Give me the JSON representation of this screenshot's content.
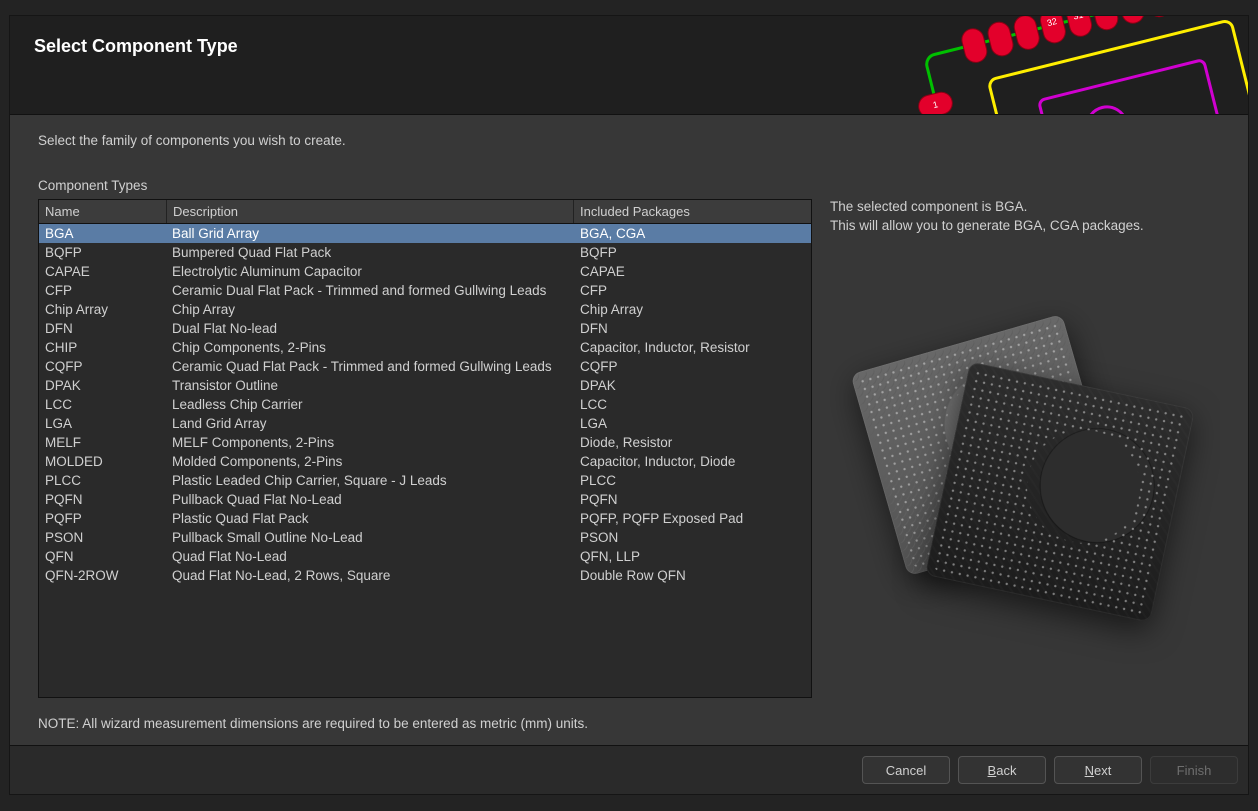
{
  "header": {
    "title": "Select Component Type"
  },
  "intro_text": "Select the family of components you wish to create.",
  "section_label": "Component Types",
  "table": {
    "headers": {
      "name": "Name",
      "description": "Description",
      "packages": "Included Packages"
    },
    "selected_index": 0,
    "rows": [
      {
        "name": "BGA",
        "desc": "Ball Grid Array",
        "pkg": "BGA, CGA"
      },
      {
        "name": "BQFP",
        "desc": "Bumpered Quad Flat Pack",
        "pkg": "BQFP"
      },
      {
        "name": "CAPAE",
        "desc": "Electrolytic Aluminum Capacitor",
        "pkg": "CAPAE"
      },
      {
        "name": "CFP",
        "desc": "Ceramic Dual Flat Pack - Trimmed and formed Gullwing Leads",
        "pkg": "CFP"
      },
      {
        "name": "Chip Array",
        "desc": "Chip Array",
        "pkg": "Chip Array"
      },
      {
        "name": "DFN",
        "desc": "Dual Flat No-lead",
        "pkg": "DFN"
      },
      {
        "name": "CHIP",
        "desc": "Chip Components, 2-Pins",
        "pkg": "Capacitor, Inductor, Resistor"
      },
      {
        "name": "CQFP",
        "desc": "Ceramic Quad Flat Pack - Trimmed and formed Gullwing Leads",
        "pkg": "CQFP"
      },
      {
        "name": "DPAK",
        "desc": "Transistor Outline",
        "pkg": "DPAK"
      },
      {
        "name": "LCC",
        "desc": "Leadless Chip Carrier",
        "pkg": "LCC"
      },
      {
        "name": "LGA",
        "desc": "Land Grid Array",
        "pkg": "LGA"
      },
      {
        "name": "MELF",
        "desc": "MELF Components, 2-Pins",
        "pkg": "Diode, Resistor"
      },
      {
        "name": "MOLDED",
        "desc": "Molded Components, 2-Pins",
        "pkg": "Capacitor, Inductor, Diode"
      },
      {
        "name": "PLCC",
        "desc": "Plastic Leaded Chip Carrier, Square - J Leads",
        "pkg": "PLCC"
      },
      {
        "name": "PQFN",
        "desc": "Pullback Quad Flat No-Lead",
        "pkg": "PQFN"
      },
      {
        "name": "PQFP",
        "desc": "Plastic Quad Flat Pack",
        "pkg": "PQFP, PQFP Exposed Pad"
      },
      {
        "name": "PSON",
        "desc": "Pullback Small Outline No-Lead",
        "pkg": "PSON"
      },
      {
        "name": "QFN",
        "desc": "Quad Flat No-Lead",
        "pkg": "QFN, LLP"
      },
      {
        "name": "QFN-2ROW",
        "desc": "Quad Flat No-Lead, 2 Rows, Square",
        "pkg": "Double Row QFN"
      }
    ]
  },
  "info": {
    "line1": "The selected component is BGA.",
    "line2": "This will allow you to generate BGA, CGA packages."
  },
  "note_text": "NOTE: All wizard measurement dimensions are required to be entered as metric (mm) units.",
  "footer": {
    "cancel": "Cancel",
    "back": "Back",
    "next": "Next",
    "finish": "Finish",
    "finish_enabled": false
  }
}
